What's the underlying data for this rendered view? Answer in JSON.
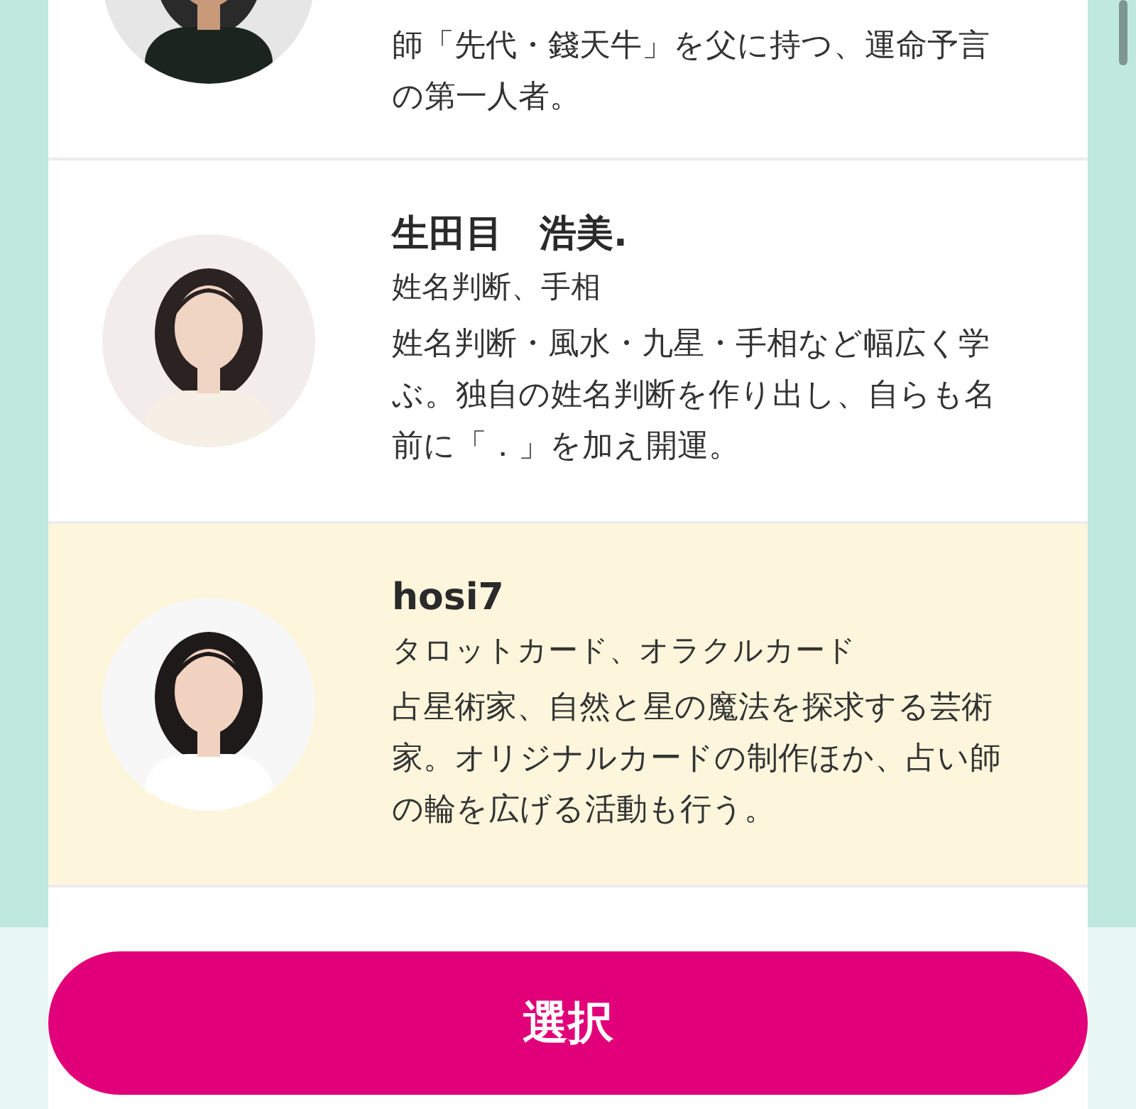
{
  "advisors": [
    {
      "description": "師「先代・錢天牛」を父に持つ、運命予言の第一人者。",
      "selected": false
    },
    {
      "name": "生田目　浩美.",
      "specialty": "姓名判断、手相",
      "description": "姓名判断・風水・九星・手相など幅広く学ぶ。独自の姓名判断を作り出し、自らも名前に「．」を加え開運。",
      "selected": false
    },
    {
      "name": "hosi7",
      "specialty": "タロットカード、オラクルカード",
      "description": "占星術家、自然と星の魔法を探求する芸術家。オリジナルカードの制作ほか、占い師の輪を広げる活動も行う。",
      "selected": true
    }
  ],
  "select_button": "選択"
}
